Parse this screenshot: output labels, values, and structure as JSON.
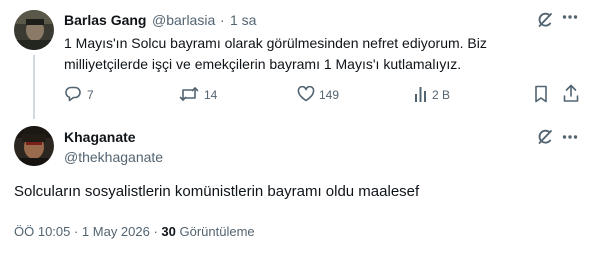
{
  "reply_tweet": {
    "display_name": "Barlas Gang",
    "handle": "@barlasia",
    "separator": "·",
    "time": "1 sa",
    "text": "1 Mayıs'ın Solcu bayramı olarak görülmesinden nefret ediyorum. Biz milliyetçilerde işçi ve emekçilerin bayramı 1 Mayıs'ı kutlamalıyız.",
    "actions": {
      "replies": "7",
      "reposts": "14",
      "likes": "149",
      "views": "2 B"
    }
  },
  "main_tweet": {
    "display_name": "Khaganate",
    "handle": "@thekhaganate",
    "text": "Solcuların sosyalistlerin komünistlerin bayramı oldu maalesef",
    "timestamp": "ÖÖ 10:05 · 1 May 2026 · ",
    "views_count": "30",
    "views_label": " Görüntüleme"
  },
  "colors": {
    "text": "#0f1419",
    "muted": "#536471",
    "thread_line": "#cfd9de"
  },
  "icons": {
    "grok": "grok-icon",
    "more": "more-icon",
    "reply": "reply-icon",
    "repost": "repost-icon",
    "like": "like-icon",
    "views": "views-icon",
    "bookmark": "bookmark-icon",
    "share": "share-icon"
  }
}
